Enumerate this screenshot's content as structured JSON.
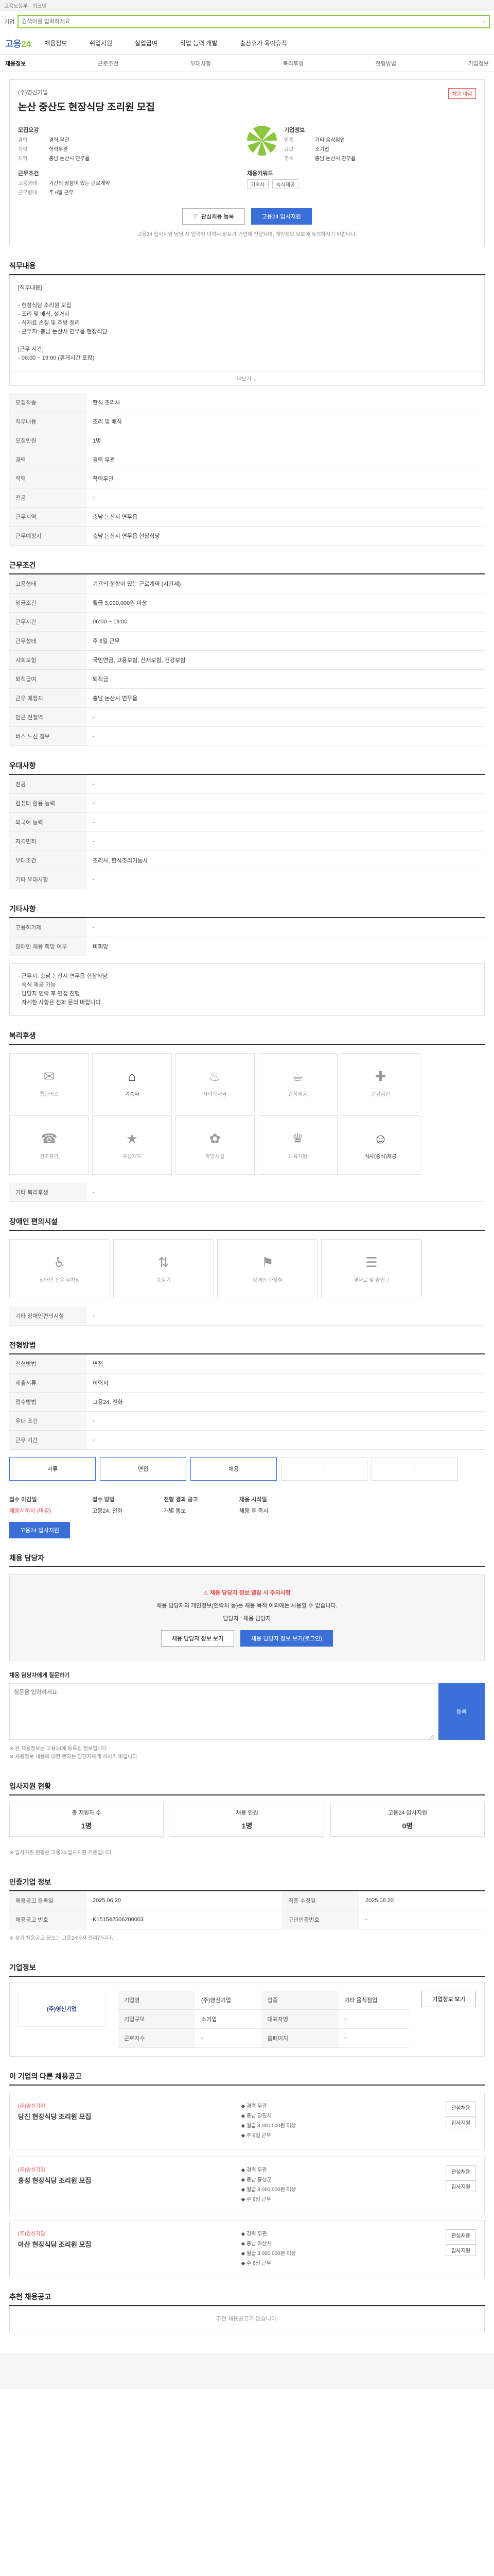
{
  "top": {
    "text": "고용노동부 · 워크넷"
  },
  "search": {
    "placeholder": "검색어를 입력하세요",
    "label": "기업"
  },
  "header": {
    "logo_pre": "고용",
    "logo_post": "24",
    "gnb": [
      "채용정보",
      "취업지원",
      "실업급여",
      "직업 능력 개발",
      "출산휴가 육아휴직"
    ]
  },
  "tabs": [
    "채용정보",
    "근로조건",
    "우대사항",
    "복리후생",
    "전형방법",
    "기업정보"
  ],
  "summary": {
    "company": "(주)영신기업",
    "title": "논산 중산도 현장식당 조리원 모집",
    "badge": "채용 마감",
    "recruit_label": "모집요강",
    "recruit": [
      {
        "k": "경력",
        "v": "경력 무관"
      },
      {
        "k": "학력",
        "v": "학력무관"
      },
      {
        "k": "지역",
        "v": "충남 논산시 연무읍"
      }
    ],
    "work_label": "근무조건",
    "work": [
      {
        "k": "고용형태",
        "v": "기간의 정함이 있는 근로계약"
      },
      {
        "k": "근무형태",
        "v": "주 6일 근무"
      }
    ],
    "side_label": "기업정보",
    "side": [
      {
        "k": "업종",
        "v": "기타 음식점업"
      },
      {
        "k": "규모",
        "v": "소기업"
      },
      {
        "k": "주소",
        "v": "충남 논산시 연무읍"
      }
    ],
    "tags_label": "채용키워드",
    "tags": [
      "기숙사",
      "숙식제공"
    ]
  },
  "buttons": {
    "save": "관심채용 등록",
    "apply": "고용24 입사지원"
  },
  "notice": "고용24 입사지원 담당 시 입력된 이력서 정보가 기업에 전달되며, 개인정보 보호에 유의하시기 바랍니다.",
  "sections": {
    "job": "직무내용",
    "conditions": "근무조건",
    "prefer": "우대사항",
    "etc": "기타사항",
    "welfare": "복리후생",
    "disabled": "장애인 편의시설",
    "process": "전형방법",
    "contact": "채용 담당자",
    "stats": "입사지원 현황",
    "ref": "인증기업 정보",
    "company": "기업정보",
    "similar": "이 기업의 다른 채용공고",
    "recommend": "추천 채용공고"
  },
  "job_desc": "[직무내용]\n\n- 현장식당 조리원 모집\n- 조리 및 배식, 설거지\n- 식재료 손질 및 주방 정리\n- 근무지: 충남 논산시 연무읍 현장식당\n\n[근무 시간]\n- 06:00 ~ 19:00 (휴게시간 포함)",
  "more": "더보기",
  "job_table": [
    {
      "k": "모집직종",
      "v": "한식 조리사"
    },
    {
      "k": "직무내용",
      "v": "조리 및 배식"
    },
    {
      "k": "모집인원",
      "v": "1명"
    },
    {
      "k": "경력",
      "v": "경력 무관"
    },
    {
      "k": "학력",
      "v": "학력무관"
    },
    {
      "k": "전공",
      "v": "-"
    },
    {
      "k": "근무지역",
      "v": "충남 논산시 연무읍"
    },
    {
      "k": "근무예정지",
      "v": "충남 논산시 연무읍 현장식당"
    }
  ],
  "cond_table": [
    {
      "k": "고용형태",
      "v": "기간의 정함이 있는 근로계약 (시간제)"
    },
    {
      "k": "임금조건",
      "v": "월급 3,000,000원 이상"
    },
    {
      "k": "근무시간",
      "v": "06:00 ~ 19:00"
    },
    {
      "k": "근무형태",
      "v": "주 6일 근무"
    },
    {
      "k": "사회보험",
      "v": "국민연금, 고용보험, 산재보험, 건강보험"
    },
    {
      "k": "퇴직급여",
      "v": "퇴직금"
    },
    {
      "k": "근무 예정지",
      "v": "충남 논산시 연무읍"
    },
    {
      "k": "인근 전철역",
      "v": "-"
    },
    {
      "k": "버스 노선 정보",
      "v": "-"
    }
  ],
  "prefer_table": [
    {
      "k": "전공",
      "v": "-"
    },
    {
      "k": "컴퓨터 활용 능력",
      "v": "-"
    },
    {
      "k": "외국어 능력",
      "v": "-"
    },
    {
      "k": "자격면허",
      "v": "-"
    },
    {
      "k": "우대조건",
      "v": "조리사, 한식조리기능사"
    },
    {
      "k": "기타 우대사항",
      "v": "-"
    }
  ],
  "etc_table": [
    {
      "k": "고용허가제",
      "v": "-"
    },
    {
      "k": "장애인 채용 희망 여부",
      "v": "비희망"
    }
  ],
  "etc_text": "· 근무지: 충남 논산시 연무읍 현장식당\n· 숙식 제공 가능\n· 담당자 연락 후 면접 진행\n· 자세한 사항은 전화 문의 바랍니다.",
  "welfare_items": [
    {
      "icon": "✉",
      "label": "통근버스",
      "on": false
    },
    {
      "icon": "⌂",
      "label": "기숙사",
      "on": true
    },
    {
      "icon": "♨",
      "label": "자녀학자금",
      "on": false
    },
    {
      "icon": "☕",
      "label": "간식제공",
      "on": false
    },
    {
      "icon": "✚",
      "label": "건강검진",
      "on": false
    },
    {
      "icon": "☎",
      "label": "경조휴가",
      "on": false
    },
    {
      "icon": "★",
      "label": "포상제도",
      "on": false
    },
    {
      "icon": "✿",
      "label": "휴양시설",
      "on": false
    },
    {
      "icon": "♛",
      "label": "교육지원",
      "on": false
    },
    {
      "icon": "☺",
      "label": "식사(중식)제공",
      "on": true
    }
  ],
  "welfare_table": [
    {
      "k": "기타 복리후생",
      "v": "-"
    }
  ],
  "disabled_items": [
    {
      "icon": "♿",
      "label": "장애인 전용 주차장"
    },
    {
      "icon": "⇅",
      "label": "승강기"
    },
    {
      "icon": "⚑",
      "label": "장애인 화장실"
    },
    {
      "icon": "☰",
      "label": "경사로 및 출입구"
    }
  ],
  "disabled_table": [
    {
      "k": "기타 장애인편의시설",
      "v": "-"
    }
  ],
  "process_table": [
    {
      "k": "전형방법",
      "v": "면접"
    },
    {
      "k": "제출서류",
      "v": "이력서"
    },
    {
      "k": "접수방법",
      "v": "고용24, 전화"
    },
    {
      "k": "우대 조건",
      "v": "-"
    },
    {
      "k": "근무 기간",
      "v": "-"
    }
  ],
  "process_steps": [
    "서류",
    "면접",
    "채용",
    "-",
    "-"
  ],
  "deadline": [
    {
      "k": "접수 마감일",
      "v": "채용시까지 (마감)"
    },
    {
      "k": "접수 방법",
      "v": "고용24, 전화"
    }
  ],
  "deadline_extra": [
    {
      "k": "전형 결과 공고",
      "v": "개별 통보"
    },
    {
      "k": "채용 시작일",
      "v": "채용 후 즉시"
    }
  ],
  "contact": {
    "warn": "채용 담당자 정보 열람 시 주의사항",
    "body": "채용 담당자의 개인정보(연락처 등)는 채용 목적 이외에는 사용할 수 없습니다.",
    "name_label": "담당자",
    "name": "채용 담당자",
    "btn1": "채용 담당자 정보 보기",
    "btn2": "채용 담당자 정보 보기(로그인)"
  },
  "memo_label": "채용 담당자에게 질문하기",
  "memo_placeholder": "질문을 입력하세요.",
  "memo_btn": "등록",
  "small_notes": [
    "※ 본 채용정보는 고용24에 등록된 정보입니다.",
    "※ 채용정보 내용에 대한 문의는 담당자에게 하시기 바랍니다."
  ],
  "stats": [
    {
      "label": "총 지원자 수",
      "value": "1명"
    },
    {
      "label": "채용 인원",
      "value": "1명"
    },
    {
      "label": "고용24 입사지원",
      "value": "0명"
    }
  ],
  "stats_note": "※ 입사지원 현황은 고용24 입사지원 기준입니다.",
  "ref_table": [
    {
      "k": "채용공고 등록일",
      "v": "2025.06.20"
    },
    {
      "k": "최종 수정일",
      "v": "2025.06.20"
    },
    {
      "k": "채용공고 번호",
      "v": "K151542506200003"
    },
    {
      "k": "구인인증번호",
      "v": "-"
    }
  ],
  "ref_note": "※ 상기 채용공고 정보는 고용24에서 관리합니다.",
  "company_card": {
    "name": "(주)영신기업",
    "rows": [
      {
        "k": "기업명",
        "v": "(주)영신기업"
      },
      {
        "k": "업종",
        "v": "기타 음식점업"
      },
      {
        "k": "기업규모",
        "v": "소기업"
      },
      {
        "k": "대표자명",
        "v": "-"
      },
      {
        "k": "근로자수",
        "v": "-"
      },
      {
        "k": "홈페이지",
        "v": "-"
      }
    ],
    "btn": "기업정보 보기"
  },
  "similar_jobs": [
    {
      "company": "(주)영신기업",
      "title": "당진 현장식당 조리원 모집",
      "bullets": [
        "◆ 경력 무관",
        "◆ 충남 당진시",
        "◆ 월급 3,000,000원 이상",
        "◆ 주 6일 근무"
      ],
      "btns": [
        "관심채용",
        "입사지원"
      ]
    },
    {
      "company": "(주)영신기업",
      "title": "홍성 현장식당 조리원 모집",
      "bullets": [
        "◆ 경력 무관",
        "◆ 충남 홍성군",
        "◆ 월급 3,000,000원 이상",
        "◆ 주 6일 근무"
      ],
      "btns": [
        "관심채용",
        "입사지원"
      ]
    },
    {
      "company": "(주)영신기업",
      "title": "아산 현장식당 조리원 모집",
      "bullets": [
        "◆ 경력 무관",
        "◆ 충남 아산시",
        "◆ 월급 3,000,000원 이상",
        "◆ 주 6일 근무"
      ],
      "btns": [
        "관심채용",
        "입사지원"
      ]
    }
  ],
  "recommend_note": "추천 채용공고가 없습니다."
}
